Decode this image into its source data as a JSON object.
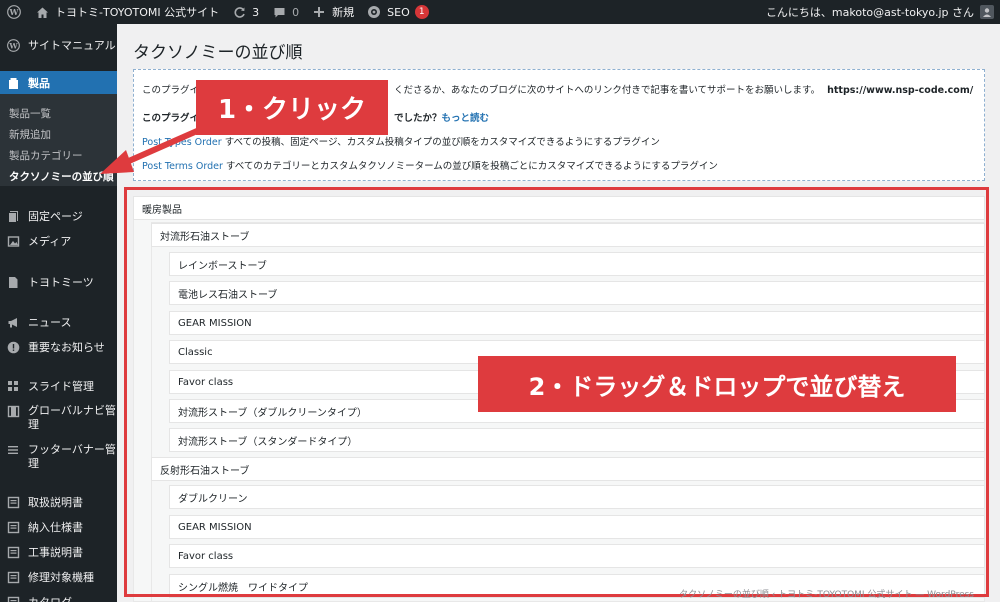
{
  "adminbar": {
    "site_name": "トヨトミ-TOYOTOMI 公式サイト",
    "updates_count": "3",
    "comments_count": "0",
    "new_label": "新規",
    "seo_label": "SEO",
    "seo_badge": "1",
    "greeting": "こんにちは、makoto@ast-tokyo.jp さん"
  },
  "sidebar": {
    "site_manual": "サイトマニュアル",
    "products": "製品",
    "submenu": [
      "製品一覧",
      "新規追加",
      "製品カテゴリー",
      "タクソノミーの並び順"
    ],
    "items": [
      "固定ページ",
      "メディア",
      "トヨトミーツ",
      "ニュース",
      "重要なお知らせ",
      "スライド管理",
      "グローバルナビ管理",
      "フッターバナー管理",
      "取扱説明書",
      "納入仕様書",
      "工事説明書",
      "修理対象機種",
      "カタログ"
    ]
  },
  "page": {
    "title": "タクソノミーの並び順"
  },
  "info": {
    "line1_a": "このプラグイ",
    "line1_b": "くださるか、あなたのブログに次のサイトへのリンク付きで記事を書いてサポートをお願いします。",
    "line1_url": "https://www.nsp-code.com/",
    "line2_a": "このプラグイ",
    "line2_b": "でしたか？",
    "line2_link": "もっと読む",
    "line3_link": "Post Types Order",
    "line3_text": "すべての投稿、固定ページ、カスタム投稿タイプの並び順をカスタマイズできるようにするプラグイン",
    "line4_link": "Post Terms Order",
    "line4_text": "すべてのカテゴリーとカスタムタクソノミータームの並び順を投稿ごとにカスタマイズできるようにするプラグイン"
  },
  "tree": {
    "root": "暖房製品",
    "group1": "対流形石油ストーブ",
    "group1_items": [
      "レインボーストーブ",
      "電池レス石油ストーブ",
      "GEAR MISSION",
      "Classic",
      "Favor class",
      "対流形ストーブ（ダブルクリーンタイプ）",
      "対流形ストーブ（スタンダードタイプ）"
    ],
    "group2": "反射形石油ストーブ",
    "group2_items": [
      "ダブルクリーン",
      "GEAR MISSION",
      "Favor class",
      "シングル燃焼　ワイドタイプ"
    ]
  },
  "annotations": {
    "step1": "1・クリック",
    "step2": "2・ドラッグ＆ドロップで並び替え",
    "color": "#de3b3e"
  },
  "footer": {
    "text": "タクソノミーの並び順 ‹ トヨトミ-TOYOTOMI 公式サイト — WordPress"
  }
}
